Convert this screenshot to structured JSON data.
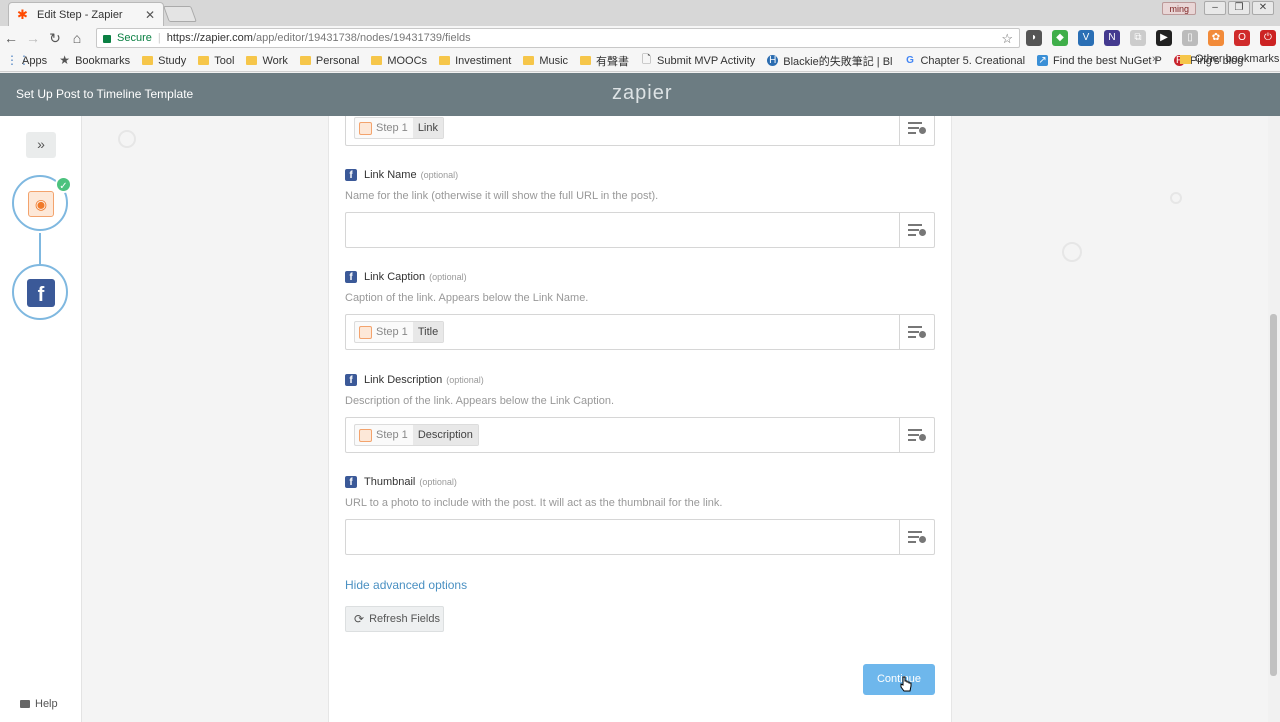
{
  "browser": {
    "tab_title": "Edit Step - Zapier",
    "user_badge": "ming",
    "secure_label": "Secure",
    "url_host": "https://zapier.com",
    "url_path": "/app/editor/19431738/nodes/19431739/fields",
    "bookmarks": [
      {
        "label": "Apps",
        "kind": "apps"
      },
      {
        "label": "Bookmarks",
        "kind": "star"
      },
      {
        "label": "Study",
        "kind": "folder"
      },
      {
        "label": "Tool",
        "kind": "folder"
      },
      {
        "label": "Work",
        "kind": "folder"
      },
      {
        "label": "Personal",
        "kind": "folder"
      },
      {
        "label": "MOOCs",
        "kind": "folder"
      },
      {
        "label": "Investiment",
        "kind": "folder"
      },
      {
        "label": "Music",
        "kind": "folder"
      },
      {
        "label": "有聲書",
        "kind": "folder"
      },
      {
        "label": "Submit MVP Activity",
        "kind": "page"
      },
      {
        "label": "Blackie的失敗筆記 | Bl",
        "kind": "site"
      },
      {
        "label": "Chapter 5. Creational",
        "kind": "google"
      },
      {
        "label": "Find the best NuGet P",
        "kind": "site"
      },
      {
        "label": "Ping's blog",
        "kind": "pinterest"
      }
    ],
    "bookmarks_more": "»",
    "other_bookmarks": "Other bookmarks"
  },
  "header": {
    "title": "Set Up Post to Timeline Template",
    "logo": "zapier"
  },
  "rail": {
    "help_label": "Help"
  },
  "fields": {
    "link_token": {
      "step": "Step 1",
      "value": "Link"
    },
    "link_name": {
      "label": "Link Name",
      "optional": "(optional)",
      "help": "Name for the link (otherwise it will show the full URL in the post)."
    },
    "link_caption": {
      "label": "Link Caption",
      "optional": "(optional)",
      "help": "Caption of the link. Appears below the Link Name.",
      "token": {
        "step": "Step 1",
        "value": "Title"
      }
    },
    "link_description": {
      "label": "Link Description",
      "optional": "(optional)",
      "help": "Description of the link. Appears below the Link Caption.",
      "token": {
        "step": "Step 1",
        "value": "Description"
      }
    },
    "thumbnail": {
      "label": "Thumbnail",
      "optional": "(optional)",
      "help": "URL to a photo to include with the post. It will act as the thumbnail for the link."
    }
  },
  "actions": {
    "hide_advanced": "Hide advanced options",
    "refresh": "Refresh Fields",
    "continue": "Continue"
  },
  "colors": {
    "header_bg": "#6c7c82",
    "accent_blue": "#6eb7ec",
    "facebook": "#3b5998",
    "rss_orange": "#f07a2a",
    "success": "#4cc27e"
  }
}
